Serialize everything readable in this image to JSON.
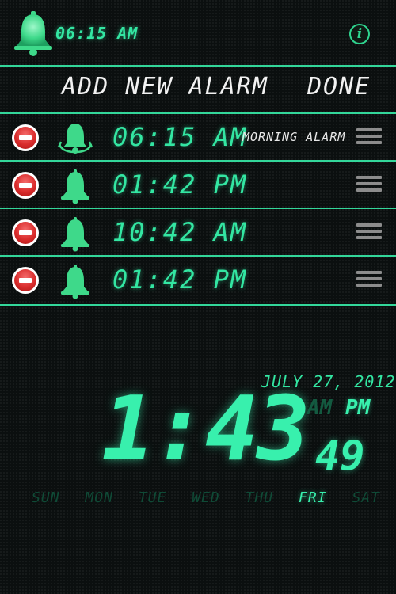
{
  "header": {
    "current_alarm_time": "06:15 AM",
    "info_label": "i"
  },
  "toolbar": {
    "add_label": "ADD NEW ALARM",
    "done_label": "DONE"
  },
  "alarms": [
    {
      "time": "06:15 AM",
      "label": "MORNING ALARM",
      "icon": "ringing-bell-icon"
    },
    {
      "time": "01:42 PM",
      "label": "",
      "icon": "bell-icon"
    },
    {
      "time": "10:42 AM",
      "label": "",
      "icon": "bell-icon"
    },
    {
      "time": "01:42 PM",
      "label": "",
      "icon": "bell-icon"
    }
  ],
  "clock": {
    "date": "JULY 27, 2012",
    "hours_minutes": "1:43",
    "seconds": "49",
    "am_label": "AM",
    "pm_label": "PM",
    "active_period": "PM",
    "days": [
      "SUN",
      "MON",
      "TUE",
      "WED",
      "THU",
      "FRI",
      "SAT"
    ],
    "active_day": "FRI"
  },
  "colors": {
    "accent": "#33e6a2",
    "divider": "#33d79a",
    "delete": "#d92c2c",
    "background": "#0b0f0f"
  }
}
